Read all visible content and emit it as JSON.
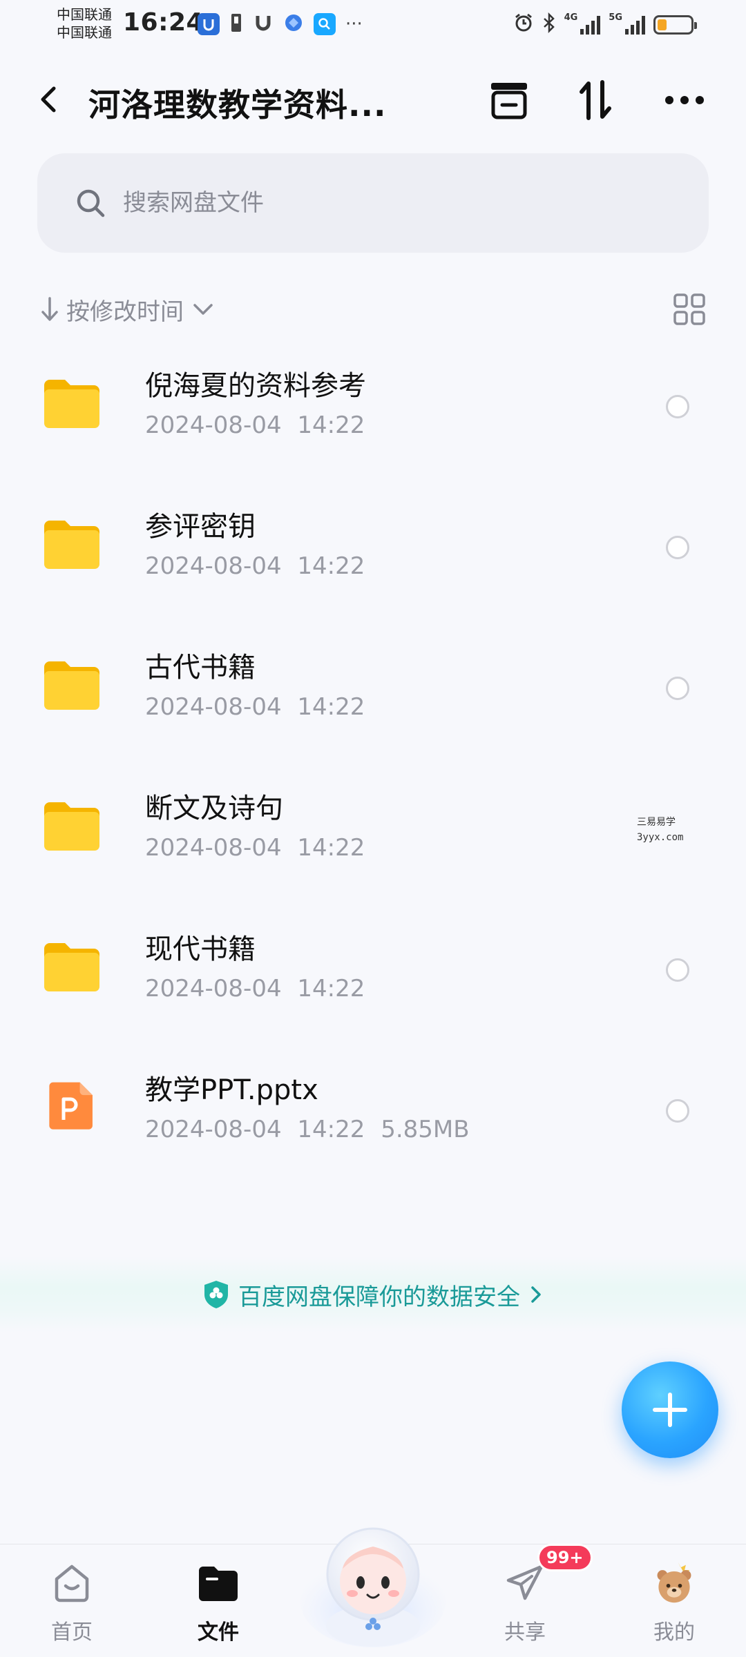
{
  "status_bar": {
    "carrier_1": "中国联通",
    "carrier_2": "中国联通",
    "time": "16:24",
    "net_1": "4G",
    "net_2": "5G",
    "more": "···"
  },
  "header": {
    "title": "河洛理数教学资料..."
  },
  "search": {
    "placeholder": "搜索网盘文件"
  },
  "sort": {
    "label": "按修改时间"
  },
  "files": [
    {
      "name": "倪海夏的资料参考",
      "date": "2024-08-04",
      "time": "14:22",
      "size": "",
      "type": "folder"
    },
    {
      "name": "参评密钥",
      "date": "2024-08-04",
      "time": "14:22",
      "size": "",
      "type": "folder"
    },
    {
      "name": "古代书籍",
      "date": "2024-08-04",
      "time": "14:22",
      "size": "",
      "type": "folder"
    },
    {
      "name": "断文及诗句",
      "date": "2024-08-04",
      "time": "14:22",
      "size": "",
      "type": "folder"
    },
    {
      "name": "现代书籍",
      "date": "2024-08-04",
      "time": "14:22",
      "size": "",
      "type": "folder"
    },
    {
      "name": "教学PPT.pptx",
      "date": "2024-08-04",
      "time": "14:22",
      "size": "5.85MB",
      "type": "pptx"
    }
  ],
  "watermark": {
    "line1": "三易易学",
    "line2": "3yyx.com"
  },
  "banner": {
    "text": "百度网盘保障你的数据安全"
  },
  "bottom_nav": {
    "home": "首页",
    "files": "文件",
    "share": "共享",
    "me": "我的",
    "share_badge": "99+"
  },
  "colors": {
    "accent": "#2aa4ff",
    "folder": "#ffd233",
    "pptx": "#ff8a3d",
    "banner_text": "#1a9a98",
    "badge": "#f43b5a"
  }
}
